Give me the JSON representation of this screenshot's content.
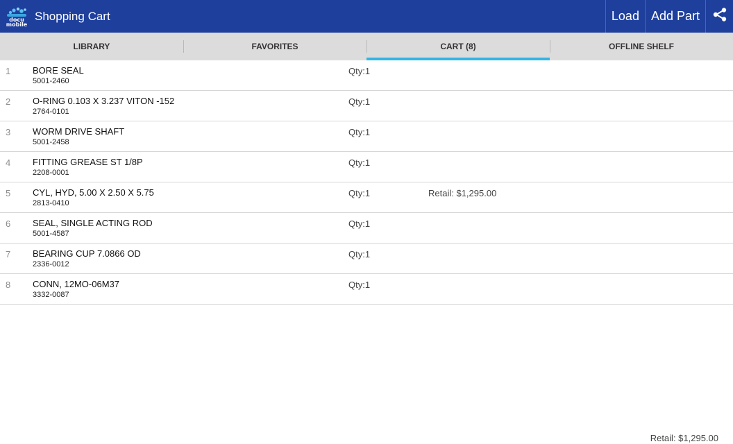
{
  "header": {
    "title": "Shopping Cart",
    "logo_text_top": "docu",
    "logo_text_bottom": "mobile",
    "load_label": "Load",
    "add_part_label": "Add Part",
    "share_icon": "share-icon"
  },
  "tabs": [
    {
      "label": "LIBRARY",
      "active": false
    },
    {
      "label": "FAVORITES",
      "active": false
    },
    {
      "label": "CART (8)",
      "active": true
    },
    {
      "label": "OFFLINE SHELF",
      "active": false
    }
  ],
  "cart": {
    "items": [
      {
        "index": "1",
        "name": "BORE SEAL",
        "part_number": "5001-2460",
        "qty": "Qty:1",
        "retail": ""
      },
      {
        "index": "2",
        "name": "O-RING 0.103 X 3.237 VITON  -152",
        "part_number": "2764-0101",
        "qty": "Qty:1",
        "retail": ""
      },
      {
        "index": "3",
        "name": "WORM DRIVE SHAFT",
        "part_number": "5001-2458",
        "qty": "Qty:1",
        "retail": ""
      },
      {
        "index": "4",
        "name": "FITTING GREASE ST 1/8P",
        "part_number": "2208-0001",
        "qty": "Qty:1",
        "retail": ""
      },
      {
        "index": "5",
        "name": "CYL, HYD, 5.00 X 2.50 X 5.75",
        "part_number": "2813-0410",
        "qty": "Qty:1",
        "retail": "Retail: $1,295.00"
      },
      {
        "index": "6",
        "name": "SEAL, SINGLE ACTING ROD",
        "part_number": "5001-4587",
        "qty": "Qty:1",
        "retail": ""
      },
      {
        "index": "7",
        "name": "BEARING CUP 7.0866 OD",
        "part_number": "2336-0012",
        "qty": "Qty:1",
        "retail": ""
      },
      {
        "index": "8",
        "name": "CONN, 12MO-06M37",
        "part_number": "3332-0087",
        "qty": "Qty:1",
        "retail": ""
      }
    ],
    "total_retail": "Retail: $1,295.00"
  },
  "colors": {
    "action_bar": "#1e3f9c",
    "tab_bar": "#dcdcdc",
    "tab_indicator": "#33b5e5"
  }
}
